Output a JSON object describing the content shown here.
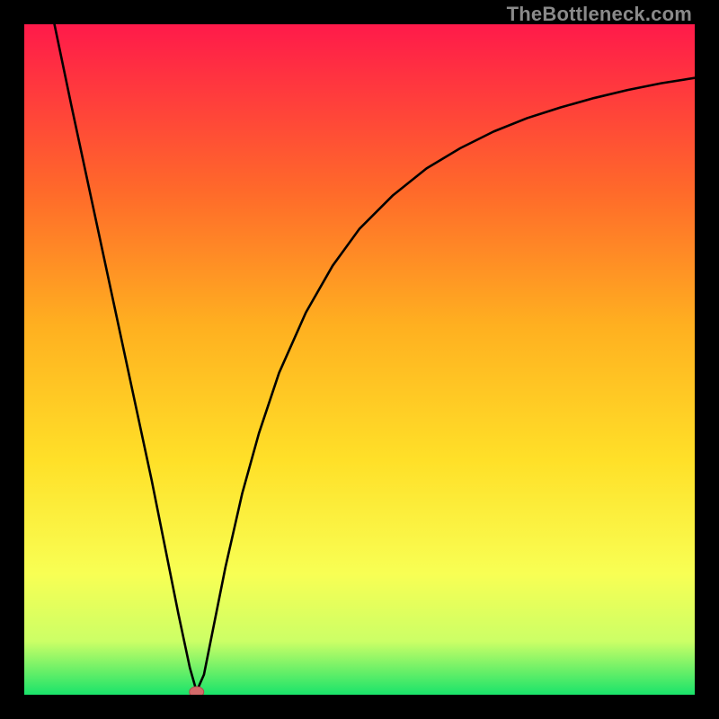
{
  "watermark": "TheBottleneck.com",
  "colors": {
    "gradient_top": "#ff1a4a",
    "gradient_mid_upper": "#ff6a2a",
    "gradient_mid": "#ffb020",
    "gradient_mid_lower": "#ffe028",
    "gradient_lower": "#f8ff54",
    "gradient_band": "#ccff66",
    "gradient_bottom": "#19e36a",
    "curve": "#000000",
    "marker_fill": "#d46a6a",
    "marker_stroke": "#b04a4a"
  },
  "chart_data": {
    "type": "line",
    "title": "",
    "xlabel": "",
    "ylabel": "",
    "xlim": [
      0,
      100
    ],
    "ylim": [
      0,
      100
    ],
    "series": [
      {
        "name": "curve",
        "x": [
          4.5,
          7,
          10,
          13,
          16,
          19,
          21,
          23,
          24.7,
          25.7,
          26.8,
          28,
          30,
          32.5,
          35,
          38,
          42,
          46,
          50,
          55,
          60,
          65,
          70,
          75,
          80,
          85,
          90,
          95,
          100
        ],
        "y": [
          100,
          88,
          74,
          60,
          46,
          32,
          22,
          12,
          4,
          0.5,
          3,
          9,
          19,
          30,
          39,
          48,
          57,
          64,
          69.5,
          74.5,
          78.5,
          81.5,
          84,
          86,
          87.6,
          89,
          90.2,
          91.2,
          92
        ]
      }
    ],
    "marker": {
      "x": 25.7,
      "y": 0.4
    },
    "axes_visible": false,
    "background": "vertical-gradient"
  }
}
